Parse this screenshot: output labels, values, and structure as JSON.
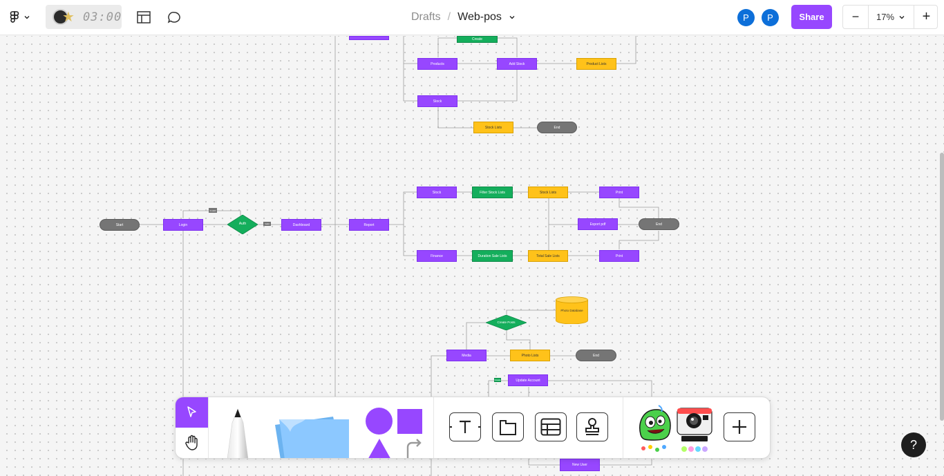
{
  "app": {
    "timer": "03:00"
  },
  "breadcrumb": {
    "parent": "Drafts",
    "separator": "/",
    "file": "Web-pos"
  },
  "users": [
    {
      "initial": "P"
    },
    {
      "initial": "P"
    }
  ],
  "share_label": "Share",
  "zoom": {
    "minus": "−",
    "value": "17%",
    "plus": "+"
  },
  "help_label": "?",
  "colors": {
    "accent": "#9747ff",
    "green": "#14ae5c",
    "yellow": "#ffc21a",
    "gray": "#757575",
    "avatar": "#0d99ff"
  },
  "flowchart": {
    "start": "Start",
    "login": "Login",
    "auth": "Auth",
    "fail_tag": "Invalid",
    "pass_tag": "Valid",
    "dashboard": "Dashboard",
    "report": "Report",
    "create_top": "Create",
    "products": "Products",
    "add_stock": "Add Stock",
    "product_lists": "Product Lists",
    "stock_top": "Stock",
    "stock_lists_top": "Stock Lists",
    "end_top": "End",
    "stock_mid": "Stock",
    "filter_stock_lists": "Filter Stock Lists",
    "stock_lists_mid": "Stock Lists",
    "print_1": "Print",
    "export_pdf": "Export pdf",
    "end_mid": "End",
    "finance": "Finance",
    "duration_sale_lists": "Duration Sale Lists",
    "total_sale_lists": "Total Sale Lists",
    "print_2": "Print",
    "create_posts": "Create Posts",
    "photo_database": "Photo Database",
    "media": "Media",
    "photo_lists": "Photo Lists",
    "end_low": "End",
    "small_tag": "Create",
    "update_account": "Update Account",
    "new_user": "New User"
  }
}
